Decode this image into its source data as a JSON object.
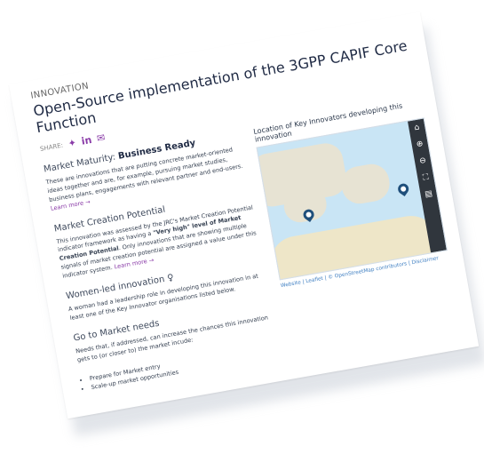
{
  "innovation": {
    "eyebrow": "INNOVATION",
    "title": "Open-Source implementation of the 3GPP CAPIF Core Function",
    "share_label": "SHARE:",
    "share_icons": [
      "twitter-icon",
      "linkedin-icon",
      "email-icon"
    ]
  },
  "market_maturity": {
    "label": "Market Maturity:",
    "value": "Business Ready",
    "description": "These are innovations that are putting concrete market-oriented ideas together and are, for example, pursuing market studies, business plans, engagements with relevant partner and end-users.",
    "learn_more": "Learn more →"
  },
  "market_creation": {
    "heading": "Market Creation Potential",
    "text_before": "This innovation was assessed by the JRC's Market Creation Potential indicator framework as having a ",
    "bold_value": "\"Very high\" level of Market Creation Potential",
    "text_after": ". Only innovations that are showing multiple signals of market creation potential are assigned a value under this indicator system.",
    "learn_more": "Learn more →"
  },
  "women_led": {
    "heading": "Women-led innovation",
    "description": "A woman had a leadership role in developing this innovation in at least one of the Key Innovator organisations listed below."
  },
  "go_to_market": {
    "heading": "Go to Market needs",
    "description": "Needs that, if addressed, can increase the chances this innovation gets to (or closer to) the market incude:",
    "needs": [
      "Prepare for Market entry",
      "Scale-up market opportunities"
    ]
  },
  "map": {
    "title": "Location of Key Innovators developing this innovation",
    "credit": "Website | Leaflet | © OpenStreetMap contributors | Disclaimer",
    "tools": [
      "home-icon",
      "zoom-in-icon",
      "zoom-out-icon",
      "fullscreen-icon",
      "print-icon"
    ],
    "colors": {
      "sea": "#c9e5f5",
      "land": "#e7e3d3",
      "pin": "#1f4f7b",
      "toolbar": "#30363d",
      "accent": "#8a3ca8"
    }
  }
}
